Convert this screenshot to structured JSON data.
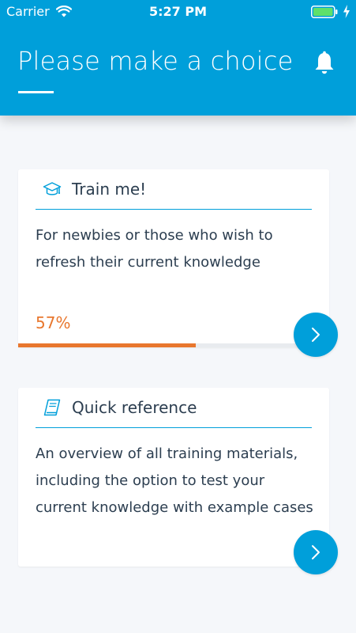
{
  "status_bar": {
    "carrier": "Carrier",
    "time": "5:27 PM",
    "wifi_icon": "wifi-icon",
    "battery_icon": "battery-icon",
    "charge_icon": "charging-bolt-icon"
  },
  "header": {
    "title": "Please make a choice",
    "notification_icon": "bell-icon",
    "background_color": "#009fda"
  },
  "choices": [
    {
      "icon": "graduation-cap-icon",
      "title": "Train me!",
      "description": "For newbies or those who wish to refresh their current knowledge",
      "progress_label": "57%",
      "progress": 0.57,
      "progress_color": "#e8772e",
      "action_icon": "chevron-right-icon"
    },
    {
      "icon": "book-icon",
      "title": "Quick reference",
      "description": "An overview of all training materials, including the option to test your current knowledge with example cases",
      "action_icon": "chevron-right-icon"
    }
  ]
}
